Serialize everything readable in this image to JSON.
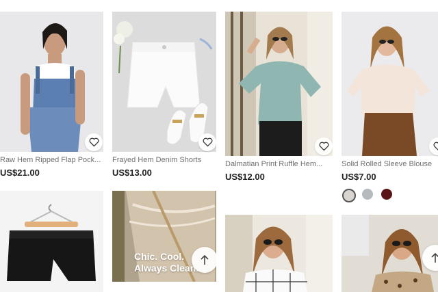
{
  "products": [
    {
      "title": "Raw Hem Ripped Flap Pock...",
      "price": "US$21.00"
    },
    {
      "title": "Frayed Hem Denim Shorts",
      "price": "US$13.00"
    },
    {
      "title": "Dalmatian Print Ruffle Hem...",
      "price": "US$12.00"
    },
    {
      "title": "Solid Rolled Sleeve Blouse",
      "price": "US$7.00",
      "swatches": [
        "#d9d6d2",
        "#b6b9be",
        "#5a1418"
      ]
    }
  ],
  "promo": {
    "line1": "Chic. Cool.",
    "line2": "Always Clean."
  },
  "icons": {
    "favorite": "heart-icon",
    "back_to_top": "arrow-up-icon"
  }
}
